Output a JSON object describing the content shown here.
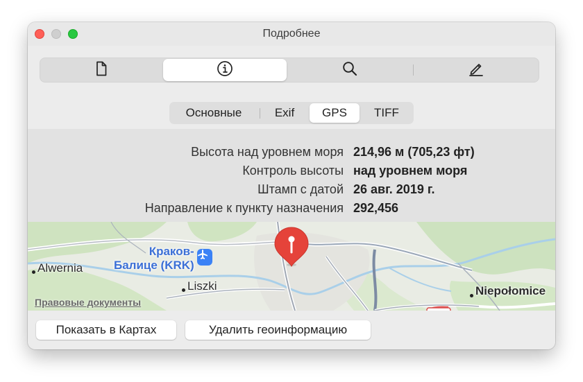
{
  "window": {
    "title": "Подробнее"
  },
  "toolbar": {
    "items": [
      {
        "icon": "document-icon"
      },
      {
        "icon": "info-icon",
        "active": true
      },
      {
        "icon": "search-icon"
      },
      {
        "icon": "pencil-icon"
      }
    ]
  },
  "tabs": {
    "items": [
      {
        "label": "Основные"
      },
      {
        "label": "Exif"
      },
      {
        "label": "GPS",
        "active": true
      },
      {
        "label": "TIFF"
      }
    ]
  },
  "gps": {
    "rows": [
      {
        "label": "Высота над уровнем моря",
        "value": "214,96 м (705,23 фт)"
      },
      {
        "label": "Контроль высоты",
        "value": "над уровнем моря"
      },
      {
        "label": "Штамп с датой",
        "value": "26 авг. 2019 г."
      },
      {
        "label": "Направление к пункту назначения",
        "value": "292,456"
      }
    ]
  },
  "map": {
    "labels": {
      "alwernia": "Alwernia",
      "airport_line1": "Краков-",
      "airport_line2": "Балице (KRK)",
      "liszki": "Liszki",
      "niepolomice": "Niepołomice"
    },
    "legal": "Правовые документы",
    "pin_color": "#e5433a"
  },
  "buttons": {
    "show_in_maps": "Показать в Картах",
    "remove_geo": "Удалить геоинформацию"
  }
}
